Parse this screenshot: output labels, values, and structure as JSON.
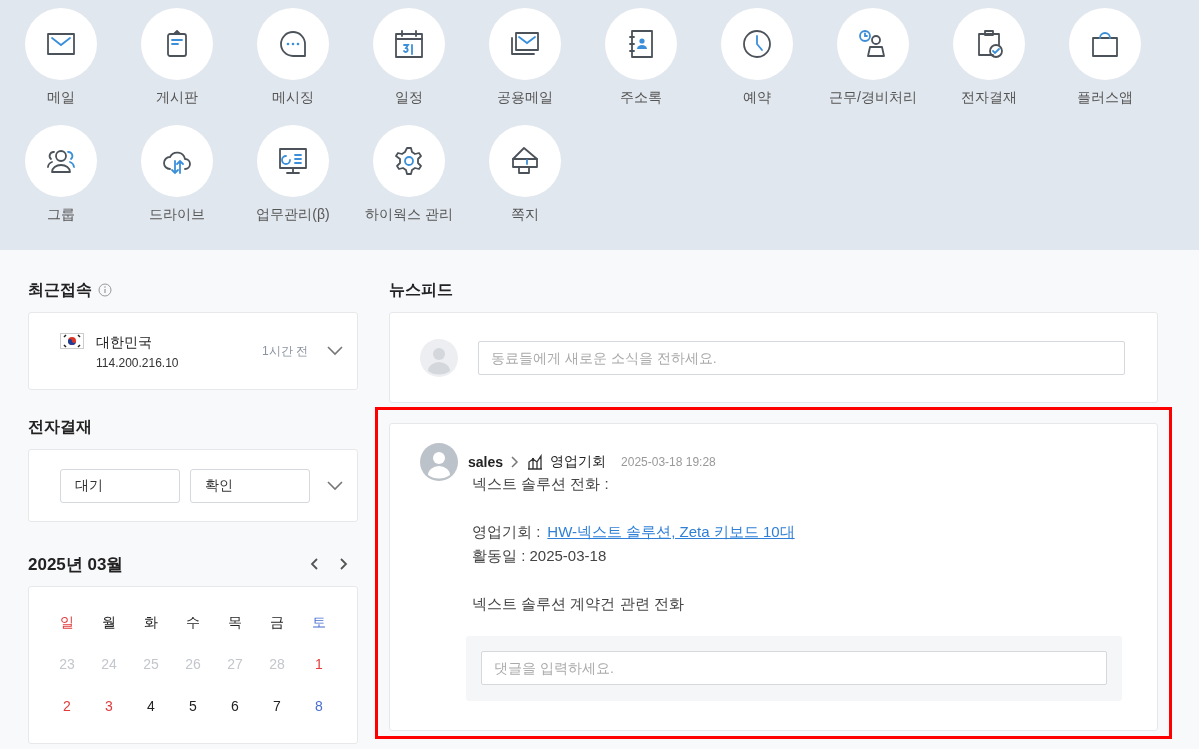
{
  "apps": [
    {
      "label": "메일"
    },
    {
      "label": "게시판"
    },
    {
      "label": "메시징"
    },
    {
      "label": "일정"
    },
    {
      "label": "공용메일"
    },
    {
      "label": "주소록"
    },
    {
      "label": "예약"
    },
    {
      "label": "근무/경비처리"
    },
    {
      "label": "전자결재"
    },
    {
      "label": "플러스앱"
    },
    {
      "label": "그룹"
    },
    {
      "label": "드라이브"
    },
    {
      "label": "업무관리(β)"
    },
    {
      "label": "하이웍스 관리"
    },
    {
      "label": "쪽지"
    }
  ],
  "recent_login": {
    "title": "최근접속",
    "country": "대한민국",
    "ip": "114.200.216.10",
    "time": "1시간 전"
  },
  "approval": {
    "title": "전자결재",
    "buttons": [
      "대기",
      "확인"
    ]
  },
  "calendar": {
    "title": "2025년 03월",
    "weekdays": [
      {
        "label": "일",
        "kind": "sunday"
      },
      {
        "label": "월",
        "kind": "weekday"
      },
      {
        "label": "화",
        "kind": "weekday"
      },
      {
        "label": "수",
        "kind": "weekday"
      },
      {
        "label": "목",
        "kind": "weekday"
      },
      {
        "label": "금",
        "kind": "weekday"
      },
      {
        "label": "토",
        "kind": "saturday"
      }
    ],
    "weeks": [
      [
        {
          "day": "23",
          "kind": "other"
        },
        {
          "day": "24",
          "kind": "other"
        },
        {
          "day": "25",
          "kind": "other"
        },
        {
          "day": "26",
          "kind": "other"
        },
        {
          "day": "27",
          "kind": "other"
        },
        {
          "day": "28",
          "kind": "other"
        },
        {
          "day": "1",
          "kind": "holiday"
        }
      ],
      [
        {
          "day": "2",
          "kind": "holiday"
        },
        {
          "day": "3",
          "kind": "holiday"
        },
        {
          "day": "4",
          "kind": "weekday"
        },
        {
          "day": "5",
          "kind": "weekday"
        },
        {
          "day": "6",
          "kind": "weekday"
        },
        {
          "day": "7",
          "kind": "weekday"
        },
        {
          "day": "8",
          "kind": "saturday"
        }
      ]
    ]
  },
  "newsfeed": {
    "title": "뉴스피드",
    "composer": {
      "placeholder": "동료들에게 새로운 소식을 전하세요."
    },
    "post": {
      "highlighted": true,
      "author": "sales",
      "board": "영업기회",
      "time": "2025-03-18 19:28",
      "paragraphs": [
        [
          {
            "kind": "text",
            "text": "넥스트 솔루션 전화 :"
          }
        ],
        [
          {
            "kind": "link",
            "label": "영업기회 :",
            "link": "HW-넥스트 솔루션, Zeta 키보드 10대"
          },
          {
            "kind": "text",
            "text": "활동일 : 2025-03-18"
          }
        ],
        [
          {
            "kind": "text",
            "text": "넥스트 솔루션 계약건 관련 전화"
          }
        ]
      ],
      "comment": {
        "placeholder": "댓글을 입력하세요."
      }
    }
  }
}
